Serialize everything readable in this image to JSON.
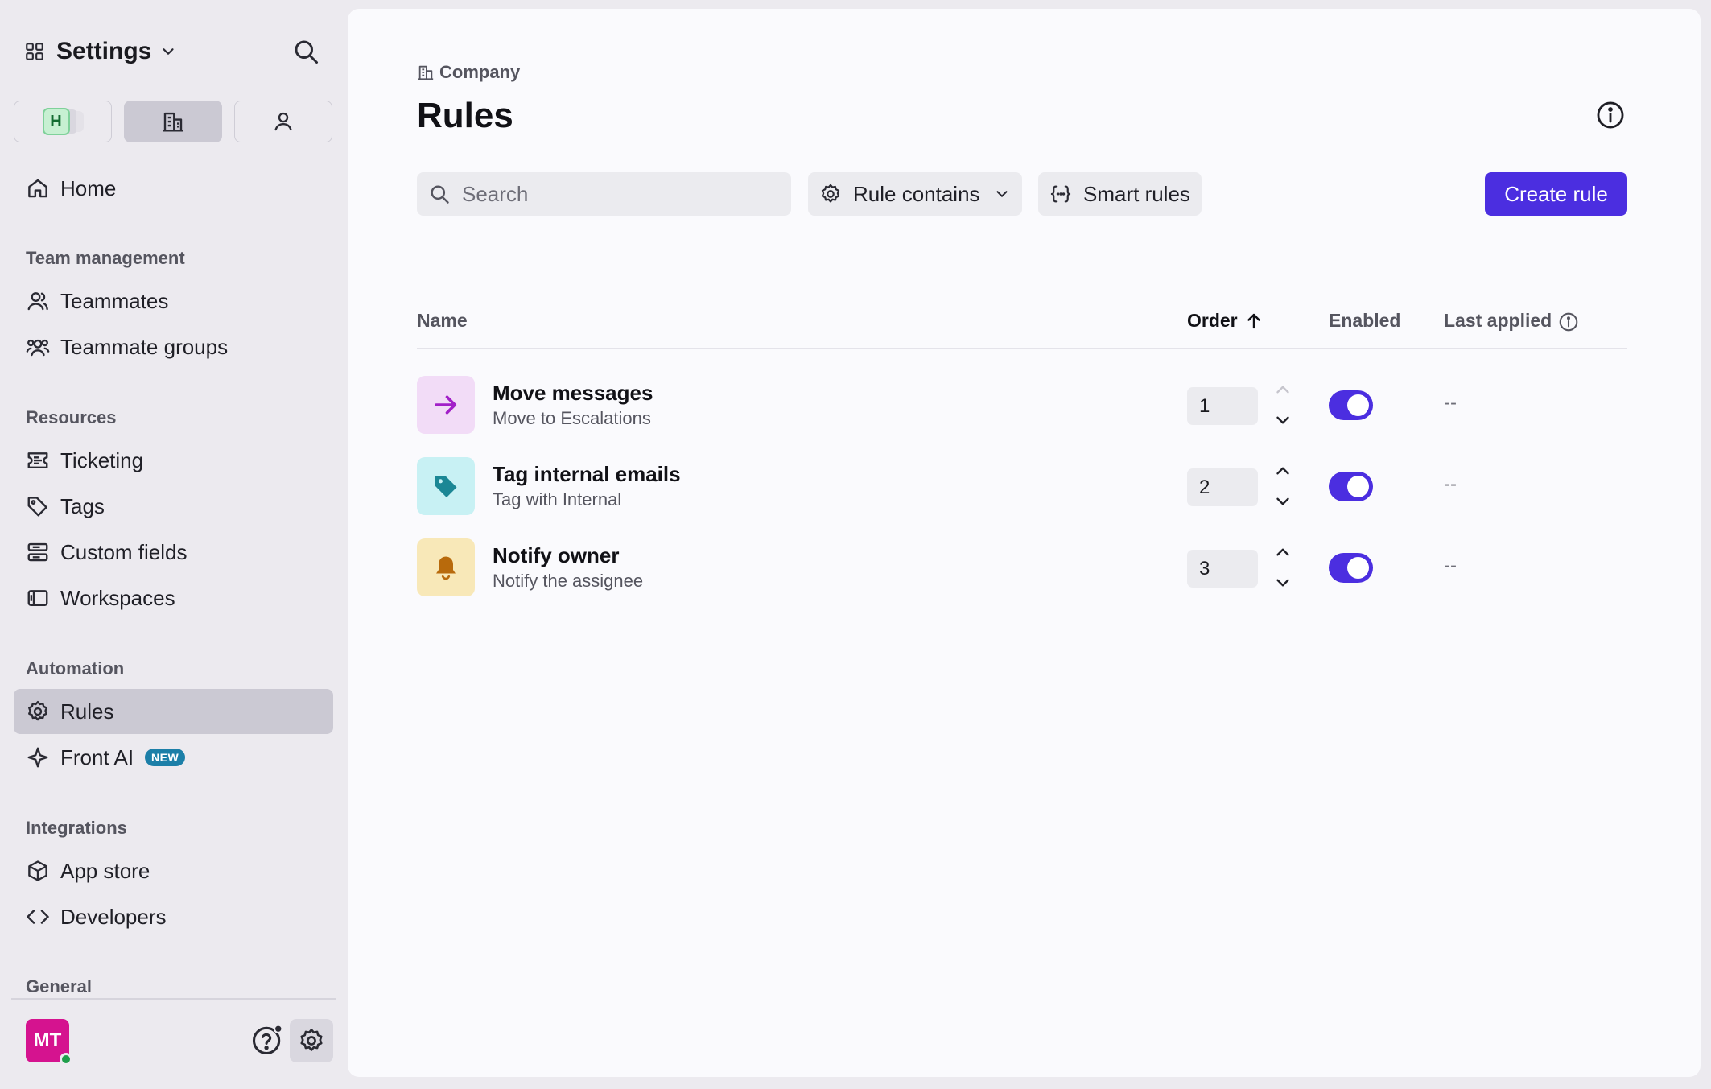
{
  "sidebar": {
    "title": "Settings",
    "sections": {
      "team": "Team management",
      "resources": "Resources",
      "automation": "Automation",
      "integrations": "Integrations",
      "general": "General"
    },
    "workspace_badge": "H",
    "items": {
      "home": "Home",
      "teammates": "Teammates",
      "teammate_groups": "Teammate groups",
      "ticketing": "Ticketing",
      "tags": "Tags",
      "custom_fields": "Custom fields",
      "workspaces": "Workspaces",
      "rules": "Rules",
      "front_ai": "Front AI",
      "app_store": "App store",
      "developers": "Developers"
    },
    "new_badge": "NEW",
    "avatar_initials": "MT",
    "presence_color": "#1e9e4a"
  },
  "main": {
    "breadcrumb": "Company",
    "title": "Rules",
    "search_placeholder": "Search",
    "filter_label": "Rule contains",
    "smart_rules_label": "Smart rules",
    "create_label": "Create rule",
    "accent_color": "#4b2ee0"
  },
  "table": {
    "columns": {
      "name": "Name",
      "order": "Order",
      "enabled": "Enabled",
      "last_applied": "Last applied"
    },
    "rows": [
      {
        "name": "Move messages",
        "desc": "Move to Escalations",
        "order": "1",
        "enabled": true,
        "last_applied": "--",
        "icon": "arrow-right-icon",
        "icon_bg": "#f2dcf7",
        "icon_color": "#a220c8"
      },
      {
        "name": "Tag internal emails",
        "desc": "Tag with Internal",
        "order": "2",
        "enabled": true,
        "last_applied": "--",
        "icon": "tag-icon",
        "icon_bg": "#c8f1f4",
        "icon_color": "#1b8795"
      },
      {
        "name": "Notify owner",
        "desc": "Notify the assignee",
        "order": "3",
        "enabled": true,
        "last_applied": "--",
        "icon": "bell-icon",
        "icon_bg": "#f8e8b8",
        "icon_color": "#b86a0c"
      }
    ]
  }
}
